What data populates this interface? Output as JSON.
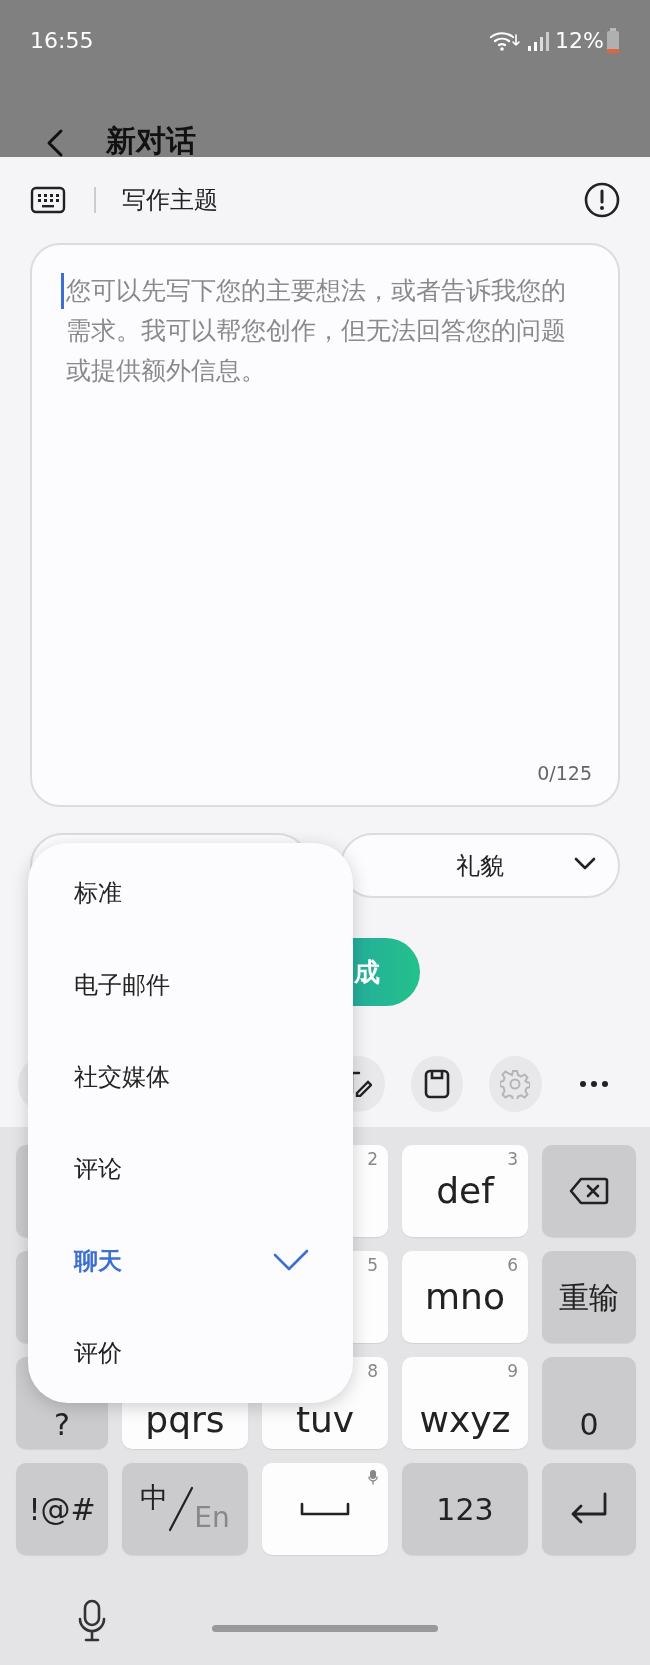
{
  "status_bar": {
    "time": "16:55",
    "battery": "12%"
  },
  "app_bar": {
    "title": "新对话"
  },
  "sheet": {
    "title": "写作主题",
    "input": {
      "placeholder": "您可以先写下您的主要想法，或者告诉我您的需求。我可以帮您创作，但无法回答您的问题或提供额外信息。",
      "counter": "0/125"
    },
    "dropdowns": [
      {
        "kind": "select"
      },
      {
        "kind": "select",
        "value": "礼貌"
      }
    ],
    "generate_button": {
      "label": "成"
    },
    "toolbar": [
      {
        "kind": "blank"
      },
      {
        "kind": "text-edit",
        "disabled": false
      },
      {
        "kind": "save",
        "disabled": false
      },
      {
        "kind": "settings",
        "disabled": true
      },
      {
        "kind": "more"
      }
    ]
  },
  "menu": {
    "items": [
      {
        "label": "标准",
        "selected": false
      },
      {
        "label": "电子邮件",
        "selected": false
      },
      {
        "label": "社交媒体",
        "selected": false
      },
      {
        "label": "评论",
        "selected": false
      },
      {
        "label": "聊天",
        "selected": true
      },
      {
        "label": "评价",
        "selected": false
      }
    ]
  },
  "keyboard": {
    "rows": [
      [
        {
          "kind": "fn"
        },
        {
          "kind": "letter"
        },
        {
          "kind": "letter",
          "number": "2"
        },
        {
          "kind": "letter",
          "label": "def",
          "number": "3"
        },
        {
          "kind": "backspace"
        }
      ],
      [
        {
          "kind": "fn"
        },
        {
          "kind": "letter"
        },
        {
          "kind": "letter",
          "number": "5"
        },
        {
          "kind": "letter",
          "label": "mno",
          "number": "6"
        },
        {
          "kind": "fn",
          "label": "重输"
        }
      ],
      [
        {
          "kind": "fn",
          "label": "?"
        },
        {
          "kind": "letter",
          "label": "pqrs"
        },
        {
          "kind": "letter",
          "label": "tuv",
          "number": "8"
        },
        {
          "kind": "letter",
          "label": "wxyz",
          "number": "9"
        },
        {
          "kind": "fn",
          "label": "0"
        }
      ],
      [
        {
          "kind": "fn",
          "label": "!@#"
        },
        {
          "kind": "lang",
          "label": "中",
          "sub": "En"
        },
        {
          "kind": "space"
        },
        {
          "kind": "fn",
          "label": "123"
        },
        {
          "kind": "enter"
        }
      ]
    ]
  }
}
